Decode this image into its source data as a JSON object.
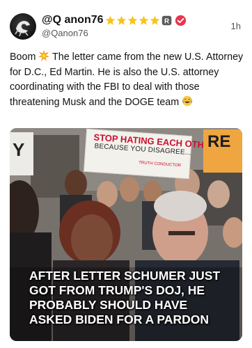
{
  "post": {
    "display_name": "@Q anon76",
    "handle": "@Qanon76",
    "timestamp": "1h",
    "badges": [
      "star-icon",
      "star-icon",
      "star-icon",
      "star-icon",
      "star-icon",
      "registered-icon",
      "verified-icon"
    ],
    "text_part1": "Boom ",
    "text_part2": " The letter came from the new U.S. Attorney for D.C., Ed Martin. He is also the U.S. attorney coordinating with the FBI to deal with those threatening Musk and the DOGE team ",
    "emojis": [
      "collision-emoji",
      "laughing-emoji"
    ]
  },
  "media": {
    "sign_main_line1": "STOP HATING EACH OTHER",
    "sign_main_line2": "BECAUSE YOU DISAGREE...",
    "sign_main_line3": "TRUTH CONDUCTOR",
    "sign_left_text": "Y",
    "sign_right_text": "RE",
    "caption": "AFTER LETTER SCHUMER JUST GOT FROM TRUMP'S DOJ, HE PROBABLY SHOULD HAVE ASKED BIDEN FOR A PARDON"
  },
  "colors": {
    "star": "#f5c518",
    "verified": "#e8364f",
    "sign_red": "#c8102e",
    "sign_orange": "#f0a640"
  }
}
